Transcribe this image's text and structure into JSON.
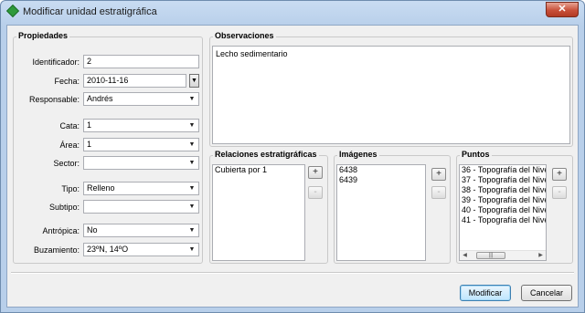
{
  "window": {
    "title": "Modificar unidad estratigráfica",
    "close_glyph": "✕"
  },
  "propiedades": {
    "title": "Propiedades",
    "identificador": {
      "label": "Identificador:",
      "value": "2"
    },
    "fecha": {
      "label": "Fecha:",
      "value": "2010-11-16"
    },
    "responsable": {
      "label": "Responsable:",
      "value": "Andrés"
    },
    "cata": {
      "label": "Cata:",
      "value": "1"
    },
    "area": {
      "label": "Área:",
      "value": "1"
    },
    "sector": {
      "label": "Sector:",
      "value": ""
    },
    "tipo": {
      "label": "Tipo:",
      "value": "Relleno"
    },
    "subtipo": {
      "label": "Subtipo:",
      "value": ""
    },
    "antropica": {
      "label": "Antrópica:",
      "value": "No"
    },
    "buzamiento": {
      "label": "Buzamiento:",
      "value": "23ºN, 14ºO"
    }
  },
  "observaciones": {
    "title": "Observaciones",
    "text": "Lecho sedimentario"
  },
  "relaciones": {
    "title": "Relaciones estratigráficas",
    "items": [
      "Cubierta por 1"
    ]
  },
  "imagenes": {
    "title": "Imágenes",
    "items": [
      "6438",
      "6439"
    ]
  },
  "puntos": {
    "title": "Puntos",
    "items": [
      "36 - Topografía del Nive",
      "37 - Topografía del Nive",
      "38 - Topografía del Nive",
      "39 - Topografía del Nive",
      "40 - Topografía del Nive",
      "41 - Topografía del Nive"
    ]
  },
  "glyphs": {
    "add": "+",
    "remove": "-",
    "dropdown": "▼",
    "left": "◀",
    "right": "▶",
    "grip": "|||"
  },
  "buttons": {
    "modificar": "Modificar",
    "cancelar": "Cancelar"
  }
}
